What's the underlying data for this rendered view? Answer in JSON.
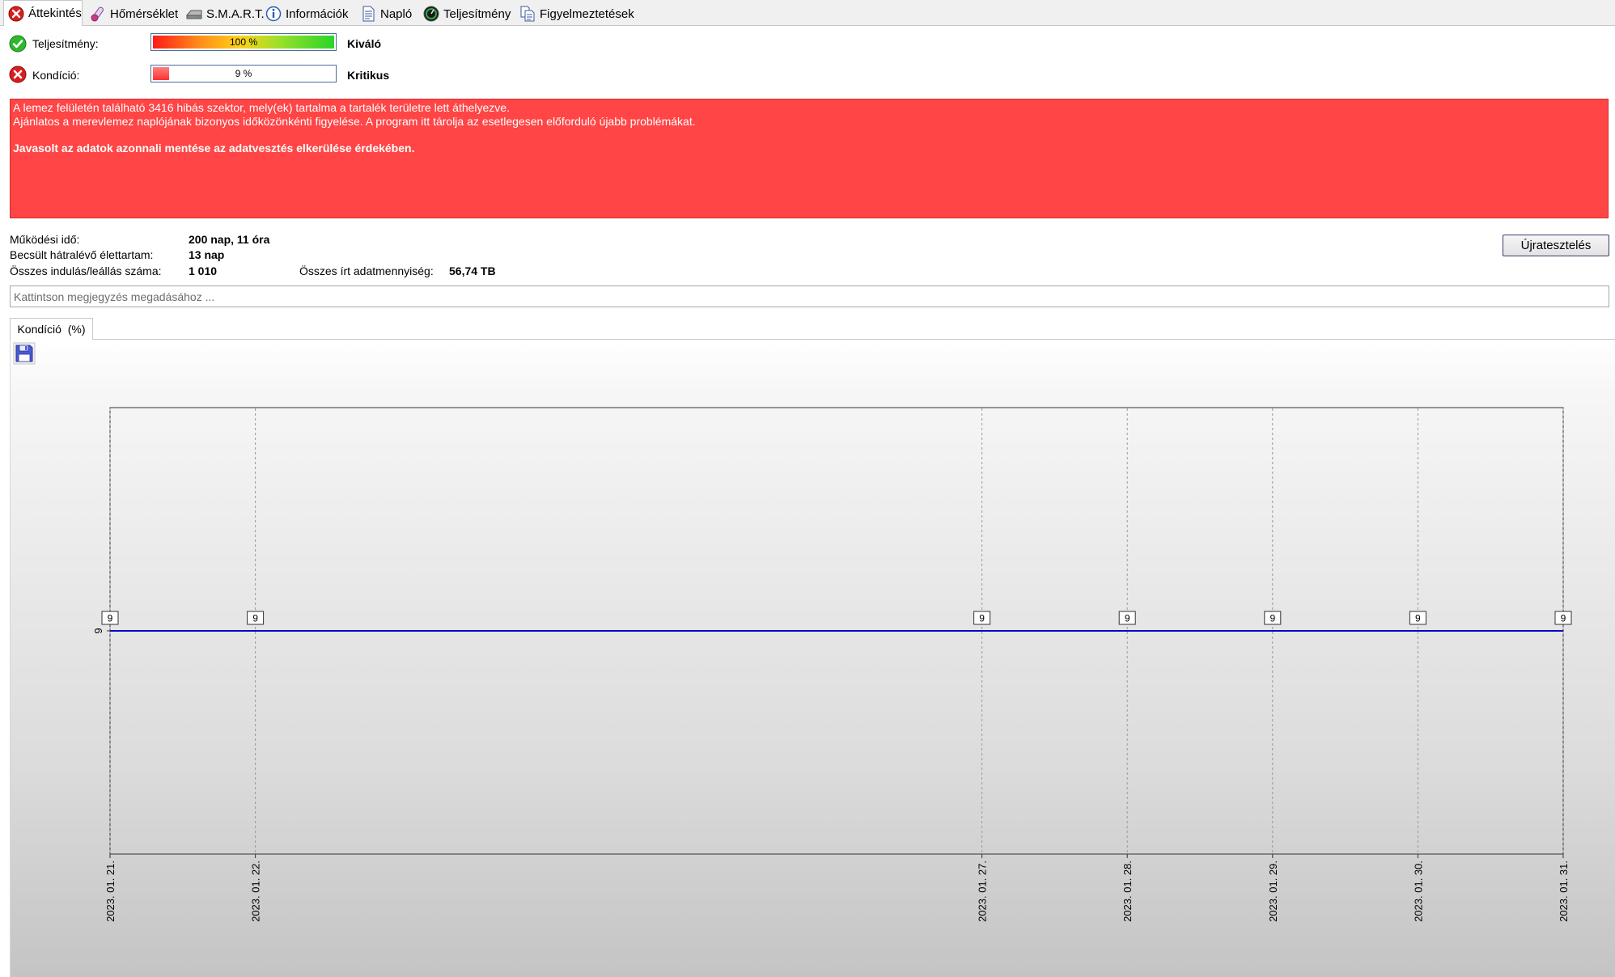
{
  "tabs": [
    {
      "label": "Áttekintés",
      "icon": "error-icon",
      "active": true
    },
    {
      "label": "Hőmérséklet",
      "icon": "thermometer-icon",
      "active": false
    },
    {
      "label": "S.M.A.R.T.",
      "icon": "drive-icon",
      "active": false
    },
    {
      "label": "Információk",
      "icon": "info-icon",
      "active": false
    },
    {
      "label": "Napló",
      "icon": "document-icon",
      "active": false
    },
    {
      "label": "Teljesítmény",
      "icon": "gauge-icon",
      "active": false
    },
    {
      "label": "Figyelmeztetések",
      "icon": "copy-icon",
      "active": false
    }
  ],
  "performance": {
    "label": "Teljesítmény:",
    "percent": 100,
    "percent_text": "100 %",
    "rating": "Kiváló",
    "status": "ok"
  },
  "condition": {
    "label": "Kondíció:",
    "percent": 9,
    "percent_text": "9 %",
    "rating": "Kritikus",
    "status": "error"
  },
  "warning": {
    "line1": "A lemez felületén található 3416 hibás szektor, mely(ek) tartalma a tartalék területre lett áthelyezve.",
    "line2": "Ajánlatos a merevlemez naplójának bizonyos időközönkénti figyelése. A program itt tárolja az esetlegesen előforduló újabb problémákat.",
    "line3": "Javasolt az adatok azonnali mentése az adatvesztés elkerülése érdekében.",
    "background": "#ff4545"
  },
  "info": {
    "uptime_label": "Működési idő:",
    "uptime_value": "200 nap, 11 óra",
    "remaining_label": "Becsült hátralévő élettartam:",
    "remaining_value": "13 nap",
    "startstop_label": "Összes indulás/leállás száma:",
    "startstop_value": "1 010",
    "written_label": "Összes írt adatmennyiség:",
    "written_value": "56,74 TB"
  },
  "retest_button": "Újratesztelés",
  "note_placeholder": "Kattintson megjegyzés megadásához ...",
  "chart_tab": "Kondíció  (%)",
  "chart_data": {
    "type": "line",
    "x": [
      "2023. 01. 21.",
      "2023. 01. 22.",
      "2023. 01. 27.",
      "2023. 01. 28.",
      "2023. 01. 29.",
      "2023. 01. 30.",
      "2023. 01. 31."
    ],
    "series": [
      {
        "values": [
          9,
          9,
          9,
          9,
          9,
          9,
          9
        ],
        "color": "#0000cc"
      }
    ],
    "yticks": [
      "9"
    ],
    "xlabel": "",
    "ylabel": "",
    "title": "",
    "grid": "vertical dashed"
  }
}
